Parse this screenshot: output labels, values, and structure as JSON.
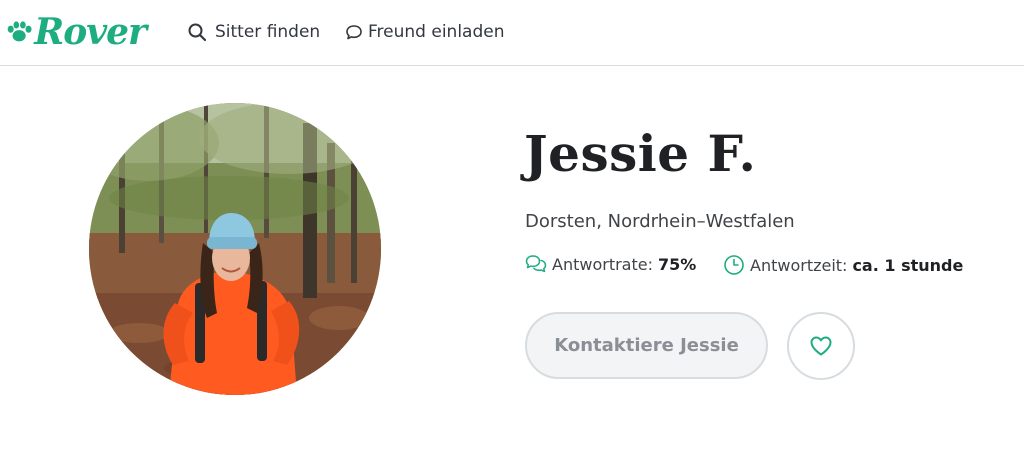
{
  "header": {
    "logo_text": "Rover",
    "nav": {
      "search_label": "Sitter finden",
      "invite_label": "Freund einladen"
    }
  },
  "profile": {
    "name": "Jessie F.",
    "location": "Dorsten, Nordrhein–Westfalen",
    "response_rate": {
      "label": "Antwortrate:",
      "value": "75%"
    },
    "response_time": {
      "label": "Antwortzeit:",
      "value": "ca. 1 stunde"
    },
    "contact_button_label": "Kontaktiere Jessie"
  },
  "colors": {
    "brand": "#1dad80",
    "text": "#1f2124",
    "muted": "#8a8f96",
    "border": "#d7dce0"
  },
  "icons": {
    "logo": "paw-icon",
    "search": "search-icon",
    "invite": "chat-bubble-icon",
    "rate": "chat-bubbles-icon",
    "time": "clock-icon",
    "favorite": "heart-icon"
  }
}
